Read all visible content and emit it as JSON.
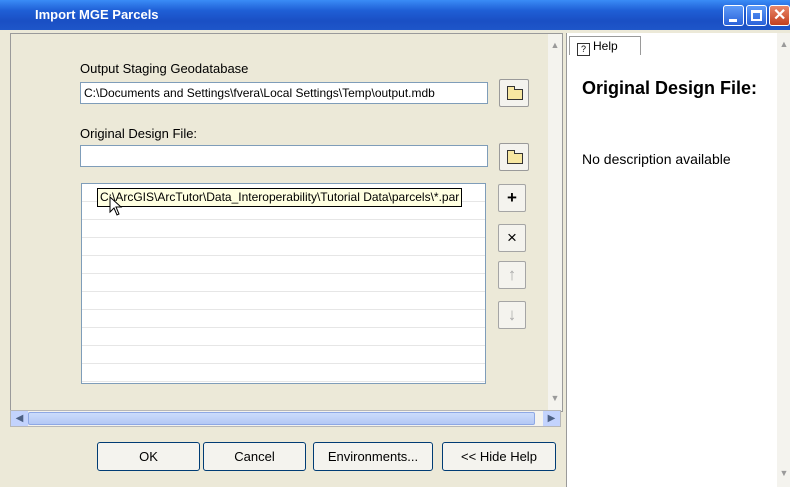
{
  "window": {
    "title": "Import MGE Parcels",
    "buttons": {
      "minimize": "minimize",
      "maximize": "maximize",
      "close": "close"
    }
  },
  "form": {
    "output_label": "Output Staging Geodatabase",
    "output_value": "C:\\Documents and Settings\\fvera\\Local Settings\\Temp\\output.mdb",
    "design_label": "Original Design File:",
    "design_value": "",
    "design_tooltip": "C:\\ArcGIS\\ArcTutor\\Data_Interoperability\\Tutorial Data\\parcels\\*.par",
    "list_rows": 11
  },
  "side_buttons": {
    "add": "+",
    "remove": "×",
    "up": "↑",
    "down": "↓"
  },
  "buttons": {
    "ok": "OK",
    "cancel": "Cancel",
    "environments": "Environments...",
    "hide_help": "<< Hide Help"
  },
  "help": {
    "tab_label": "Help",
    "title": "Original Design File:",
    "description": "No description available"
  },
  "icons": {
    "browse": "folder-open-icon",
    "help": "help-icon",
    "cursor": "mouse-pointer-icon"
  },
  "colors": {
    "titlebar": "#1f5fd6",
    "dialog_bg": "#ece9d8",
    "tooltip_bg": "#ffffe1"
  }
}
